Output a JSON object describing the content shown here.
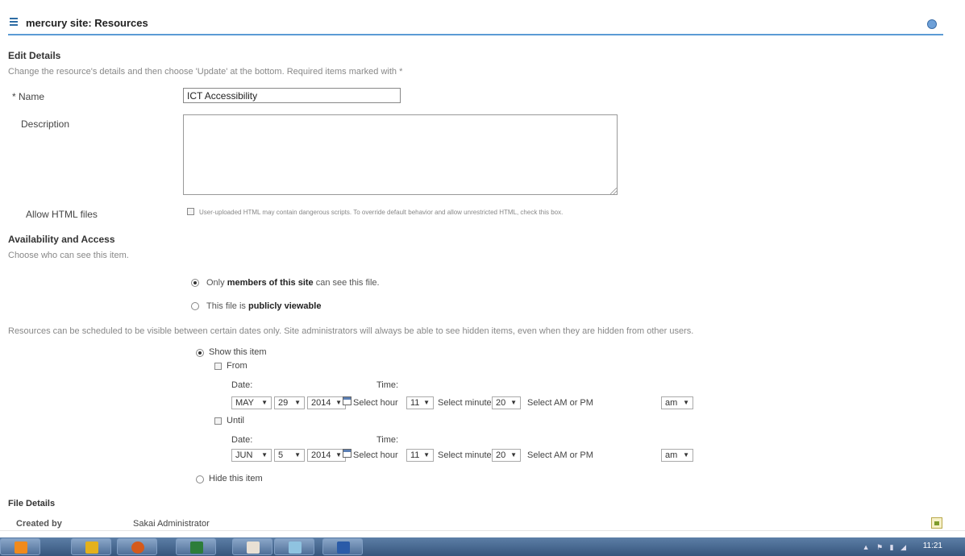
{
  "header": {
    "title": "mercury site: Resources",
    "help_icon": "help-icon",
    "menu_icon": "menu-icon"
  },
  "edit": {
    "heading": "Edit Details",
    "instructions": "Change the resource's details and then choose 'Update' at the bottom. Required items marked with *",
    "name_label": "* Name",
    "name_value": "ICT Accessibility",
    "description_label": "Description",
    "description_value": "",
    "allow_html_label": "Allow HTML files",
    "allow_html_text": "User-uploaded HTML may contain dangerous scripts. To override default behavior and allow unrestricted HTML, check this box.",
    "allow_html_checked": false
  },
  "access": {
    "heading": "Availability and Access",
    "subtext": "Choose who can see this item.",
    "option_members_pre": "Only ",
    "option_members_bold": "members of this site",
    "option_members_post": " can see this file.",
    "option_public_pre": "This file is ",
    "option_public_bold": "publicly viewable",
    "selected": "members"
  },
  "schedule": {
    "note": "Resources can be scheduled to be visible between certain dates only. Site administrators will always be able to see hidden items, even when they are hidden from other users.",
    "show_label": "Show this item",
    "hide_label": "Hide this item",
    "selected": "show",
    "date_label": "Date:",
    "time_label": "Time:",
    "select_hour_label": "Select hour",
    "select_minute_label": "Select minute",
    "select_ampm_label": "Select AM or PM",
    "from": {
      "label": "From",
      "checked": false,
      "month": "MAY",
      "day": "29",
      "year": "2014",
      "hour": "11",
      "minute": "20",
      "ampm": "am"
    },
    "until": {
      "label": "Until",
      "checked": false,
      "month": "JUN",
      "day": "5",
      "year": "2014",
      "hour": "11",
      "minute": "20",
      "ampm": "am"
    }
  },
  "file_details": {
    "heading": "File Details",
    "created_by_label": "Created by",
    "created_by_value": "Sakai Administrator"
  },
  "taskbar": {
    "apps": [
      "vlc-icon",
      "filezilla-icon",
      "firefox-icon",
      "excel-icon",
      "java-icon",
      "network-icon",
      "word-icon"
    ],
    "clock": "11:21"
  }
}
